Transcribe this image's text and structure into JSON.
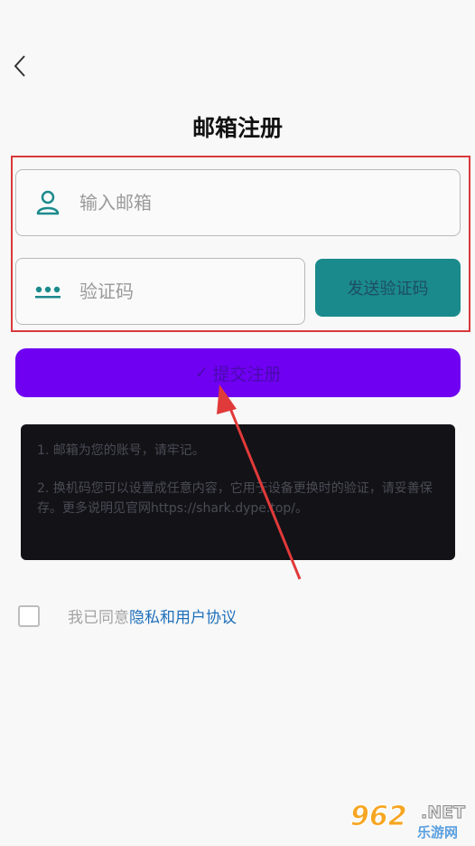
{
  "header": {
    "title": "邮箱注册"
  },
  "form": {
    "email_placeholder": "输入邮箱",
    "code_placeholder": "验证码",
    "send_code_label": "发送验证码",
    "submit_check": "✓",
    "submit_label": "提交注册"
  },
  "notice": {
    "line1": "1. 邮箱为您的账号，请牢记。",
    "line2": "2. 换机码您可以设置成任意内容，它用于设备更换时的验证，请妥善保存。更多说明见官网https://shark.dype.top/。"
  },
  "agreement": {
    "prefix": "我已同意",
    "link": "隐私和用户协议"
  },
  "watermark": {
    "number": "962",
    "suffix": ".NET",
    "sub": "乐游网"
  },
  "colors": {
    "accent_teal": "#1b8a8c",
    "submit_purple": "#7000f2",
    "link_blue": "#1e6fba",
    "annotation_red": "#d9393b"
  }
}
